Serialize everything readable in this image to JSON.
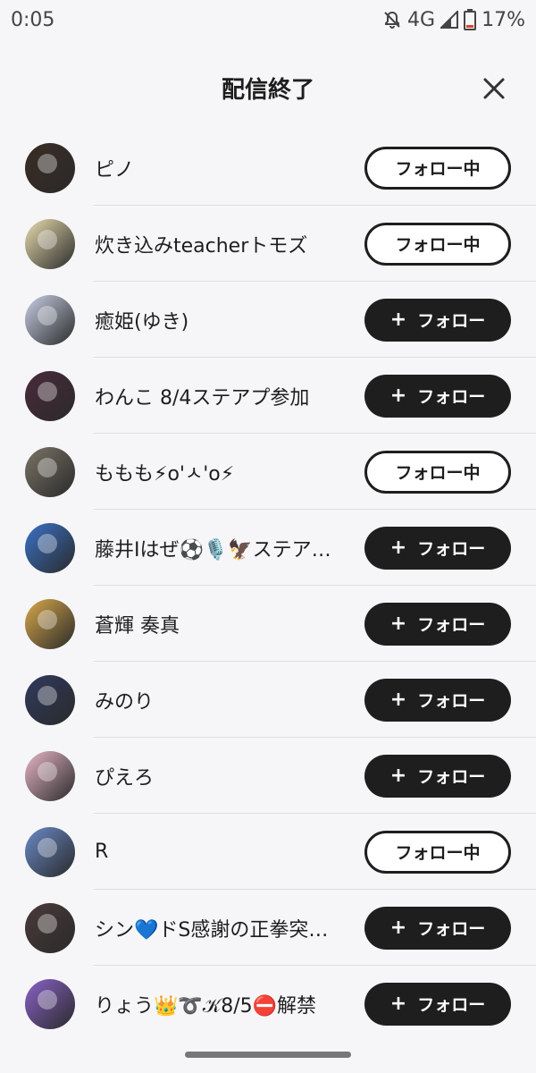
{
  "status_bar": {
    "time": "0:05",
    "network": "4G",
    "battery": "17%",
    "icons": [
      "notifications-off-icon",
      "signal-icon",
      "battery-icon"
    ]
  },
  "header": {
    "title": "配信終了",
    "close_icon": "close-icon"
  },
  "labels": {
    "following": "フォロー中",
    "follow": "フォロー",
    "follow_icon": "plus-icon"
  },
  "accent": {
    "primary": "#1e1e1e",
    "background": "#f6f6f8"
  },
  "users": [
    {
      "name": "ピノ",
      "status": "following",
      "avatar_color": "#3a2c24"
    },
    {
      "name": "炊き込みteacherトモズ",
      "status": "following",
      "avatar_color": "#e8dcae"
    },
    {
      "name": "癒姫(ゆき)",
      "status": "follow",
      "avatar_color": "#c8cfe6"
    },
    {
      "name": "わんこ 8/4ステアプ参加",
      "status": "follow",
      "avatar_color": "#4a2a3a"
    },
    {
      "name": "ももも⚡o'ㅅ'o⚡",
      "status": "following",
      "avatar_color": "#7a7466"
    },
    {
      "name": "藤井Iはぜ⚽️🎙️🦅ステア…",
      "status": "follow",
      "avatar_color": "#3a72c8"
    },
    {
      "name": "蒼輝 奏真",
      "status": "follow",
      "avatar_color": "#d9a84a"
    },
    {
      "name": "みのり",
      "status": "follow",
      "avatar_color": "#2f3a5e"
    },
    {
      "name": "ぴえろ",
      "status": "follow",
      "avatar_color": "#e7b6c6"
    },
    {
      "name": "R",
      "status": "following",
      "avatar_color": "#6a8ac8"
    },
    {
      "name": "シン💙ドS感謝の正拳突…",
      "status": "follow",
      "avatar_color": "#4a3a3a"
    },
    {
      "name": "りょう👑➰𝒦8/5⛔解禁",
      "status": "follow",
      "avatar_color": "#8a62c8"
    }
  ]
}
